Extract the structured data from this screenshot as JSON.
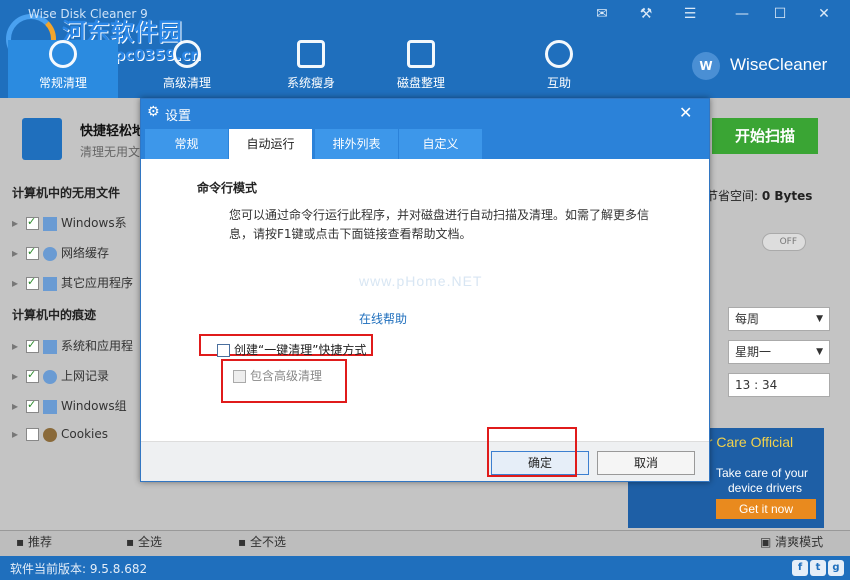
{
  "app": {
    "title": "Wise Disk Cleaner 9",
    "brand": "WiseCleaner",
    "watermark_cn": "河东软件园",
    "watermark_url": "www.pc0359.cn"
  },
  "nav": {
    "tabs": [
      {
        "label": "常规清理",
        "icon": "broom-icon"
      },
      {
        "label": "高级清理",
        "icon": "advanced-clean-icon"
      },
      {
        "label": "系统瘦身",
        "icon": "windows-icon"
      },
      {
        "label": "磁盘整理",
        "icon": "defrag-icon"
      },
      {
        "label": "互助",
        "icon": "gear-help-icon"
      }
    ]
  },
  "main": {
    "quick_title": "快捷轻松地",
    "quick_sub": "清理无用文",
    "scan_button": "开始扫描",
    "section1": "计算机中的无用文件",
    "section1_items": [
      {
        "label": "Windows系",
        "checked": true
      },
      {
        "label": "网络缓存",
        "checked": true
      },
      {
        "label": "其它应用程序",
        "checked": true
      }
    ],
    "section2": "计算机中的痕迹",
    "section2_items": [
      {
        "label": "系统和应用程",
        "checked": true
      },
      {
        "label": "上网记录",
        "checked": true
      },
      {
        "label": "Windows组",
        "checked": true
      },
      {
        "label": "Cookies",
        "checked": false
      }
    ],
    "save_label": "节省空间: ",
    "save_value": "0 Bytes",
    "toggle_text": "OFF",
    "schedule_freq": "每周",
    "schedule_day": "星期一",
    "schedule_time": "13 : 34"
  },
  "ad": {
    "title": "er Care Official",
    "text1": "Take care of your",
    "text2": "device drivers",
    "button": "Get it now"
  },
  "bottom": {
    "recommend": "推荐",
    "select_all": "全选",
    "select_none": "全不选",
    "clean_mode": "清爽模式"
  },
  "status": {
    "version": "软件当前版本: 9.5.8.682"
  },
  "dialog": {
    "title": "设置",
    "tabs": [
      "常规",
      "自动运行",
      "排外列表",
      "自定义"
    ],
    "active_tab": 1,
    "mode_title": "命令行模式",
    "description": "您可以通过命令行运行此程序，并对磁盘进行自动扫描及清理。如需了解更多信息，请按F1键或点击下面链接查看帮助文档。",
    "watermark": "www.pHome.NET",
    "help_link": "在线帮助",
    "checkbox_shortcut": "创建“一键清理”快捷方式",
    "checkbox_advanced": "包含高级清理",
    "ok_button": "确定",
    "cancel_button": "取消"
  },
  "colors": {
    "titlebar": "#1f6fbd",
    "accent": "#2b82d9",
    "scan_green": "#3aa534",
    "highlight_red": "#e01b1b"
  }
}
